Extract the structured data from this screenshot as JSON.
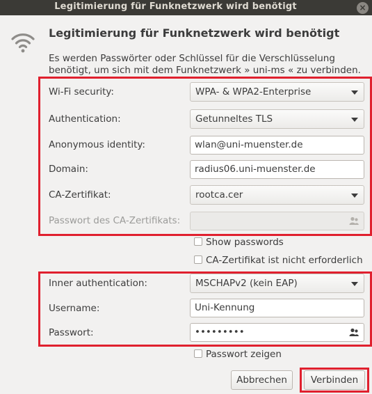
{
  "window": {
    "title": "Legitimierung für Funknetzwerk wird benötigt"
  },
  "dialog": {
    "heading": "Legitimierung für Funknetzwerk wird benötigt",
    "description_line1": "Es werden Passwörter oder Schlüssel für die Verschlüsselung",
    "description_line2_a": "benötigt, um sich mit dem Funknetzwerk »",
    "network_name": "uni-ms",
    "description_line2_b": "« zu verbinden."
  },
  "form": {
    "wifi_security": {
      "label": "Wi-Fi security:",
      "value": "WPA- & WPA2-Enterprise"
    },
    "authentication": {
      "label": "Authentication:",
      "value": "Getunneltes TLS"
    },
    "anonymous_identity": {
      "label": "Anonymous identity:",
      "value": "wlan@uni-muenster.de"
    },
    "domain": {
      "label": "Domain:",
      "value": "radius06.uni-muenster.de"
    },
    "ca_certificate": {
      "label": "CA-Zertifikat:",
      "value": "rootca.cer"
    },
    "ca_password": {
      "label": "Passwort des CA-Zertifikats:",
      "value": ""
    },
    "show_passwords": {
      "label": "Show passwords",
      "checked": false
    },
    "ca_not_required": {
      "label": "CA-Zertifikat ist nicht erforderlich",
      "checked": false
    },
    "inner_authentication": {
      "label": "Inner authentication:",
      "value": "MSCHAPv2 (kein EAP)"
    },
    "username": {
      "label": "Username:",
      "value": "Uni-Kennung"
    },
    "password": {
      "label": "Passwort:",
      "value": "•••••••••"
    },
    "show_password": {
      "label": "Passwort zeigen",
      "checked": false
    }
  },
  "buttons": {
    "cancel": "Abbrechen",
    "connect": "Verbinden"
  },
  "colors": {
    "highlight": "#e0202e",
    "titlebar": "#3b3a36",
    "background": "#f2f1f0"
  },
  "icons": [
    "close-icon",
    "wifi-icon",
    "dropdown-arrow-icon",
    "user-group-icon"
  ]
}
